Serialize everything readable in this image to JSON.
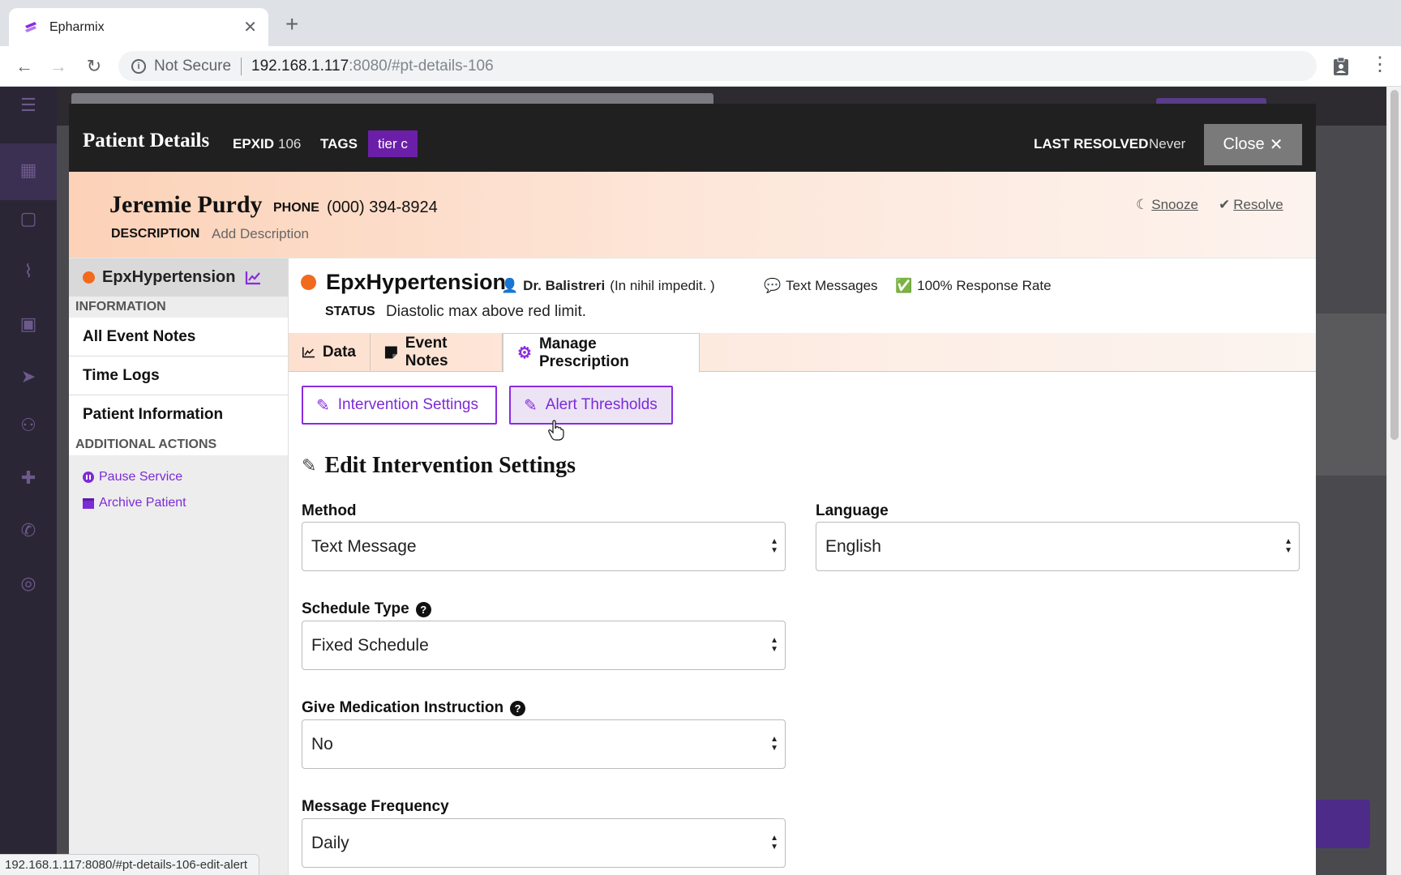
{
  "browser": {
    "tab_title": "Epharmix",
    "not_secure": "Not Secure",
    "url_host": "192.168.1.117",
    "url_rest": ":8080/#pt-details-106",
    "status_url": "192.168.1.117:8080/#pt-details-106-edit-alert"
  },
  "modal": {
    "title": "Patient Details",
    "epxid_label": "EPXID",
    "epxid": "106",
    "tags_label": "TAGS",
    "tag": "tier c",
    "last_resolved_label": "LAST RESOLVED",
    "last_resolved": "Never",
    "close_label": "Close"
  },
  "patient": {
    "name": "Jeremie Purdy",
    "phone_label": "PHONE",
    "phone": "(000) 394-8924",
    "description_label": "DESCRIPTION",
    "description_placeholder": "Add Description",
    "snooze": "Snooze",
    "resolve": "Resolve"
  },
  "left_menu": {
    "program": "EpxHypertension",
    "information_label": "INFORMATION",
    "items": [
      "All Event Notes",
      "Time Logs",
      "Patient Information"
    ],
    "additional_label": "ADDITIONAL ACTIONS",
    "pause": "Pause Service",
    "archive": "Archive Patient"
  },
  "program": {
    "name": "EpxHypertension",
    "doctor": "Dr. Balistreri",
    "doctor_note": "(In nihil impedit. )",
    "channel": "Text Messages",
    "response_rate": "100% Response Rate",
    "status_label": "STATUS",
    "status": "Diastolic max above red limit."
  },
  "tabs": [
    "Data",
    "Event Notes",
    "Manage Prescription"
  ],
  "subtabs": {
    "intervention": "Intervention Settings",
    "alerts": "Alert Thresholds"
  },
  "form": {
    "title": "Edit Intervention Settings",
    "method_label": "Method",
    "method_value": "Text Message",
    "language_label": "Language",
    "language_value": "English",
    "schedule_label": "Schedule Type",
    "schedule_value": "Fixed Schedule",
    "medication_label": "Give Medication Instruction",
    "medication_value": "No",
    "frequency_label": "Message Frequency",
    "frequency_value": "Daily"
  },
  "colors": {
    "accent": "#8a2be2",
    "status_dot": "#f26a1b",
    "header_bg": "#202020"
  }
}
